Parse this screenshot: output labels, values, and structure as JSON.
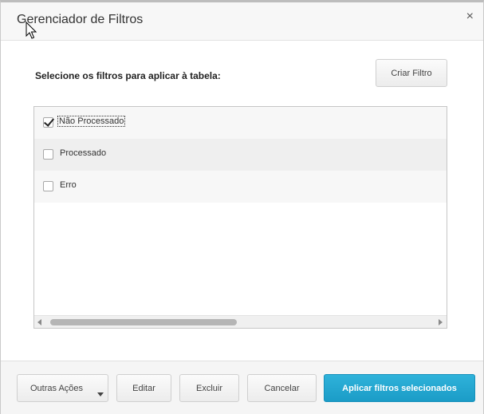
{
  "dialog": {
    "title": "Gerenciador de Filtros",
    "close_glyph": "×",
    "instruction": "Selecione os filtros para aplicar à tabela:",
    "create_button": "Criar Filtro"
  },
  "filters": [
    {
      "label": "Não Processado",
      "checked": true
    },
    {
      "label": "Processado",
      "checked": false
    },
    {
      "label": "Erro",
      "checked": false
    }
  ],
  "footer": {
    "more_actions": "Outras Ações",
    "edit": "Editar",
    "delete": "Excluir",
    "cancel": "Cancelar",
    "apply": "Aplicar filtros selecionados"
  },
  "colors": {
    "accent": "#1b9cc7"
  },
  "icons": {
    "close": "close-icon",
    "dropdown": "caret-down-icon",
    "checkbox": "checkbox-icon",
    "scroll_left": "arrow-left-icon",
    "scroll_right": "arrow-right-icon",
    "cursor": "mouse-pointer-icon"
  }
}
